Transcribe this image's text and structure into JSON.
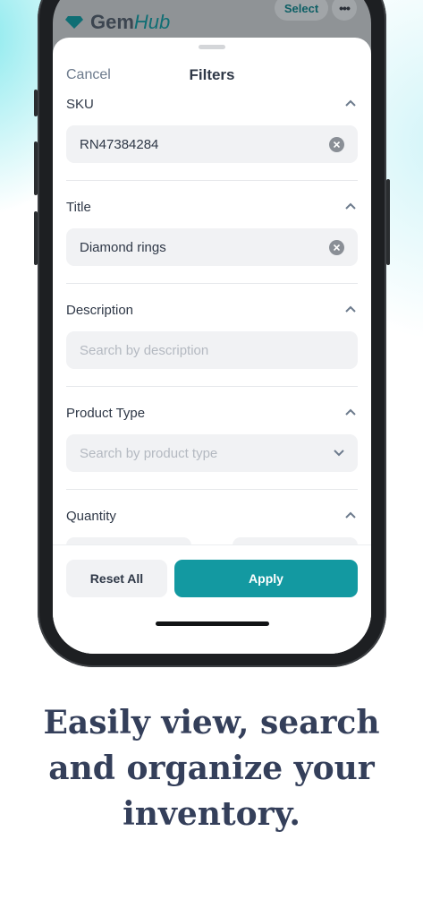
{
  "app": {
    "logo_main": "Gem",
    "logo_accent": "Hub",
    "select_label": "Select",
    "more_label": "•••"
  },
  "sheet": {
    "cancel_label": "Cancel",
    "title": "Filters"
  },
  "filters": {
    "sku": {
      "label": "SKU",
      "value": "RN47384284"
    },
    "title": {
      "label": "Title",
      "value": "Diamond rings"
    },
    "description": {
      "label": "Description",
      "placeholder": "Search by description"
    },
    "product_type": {
      "label": "Product Type",
      "placeholder": "Search by product type"
    },
    "quantity": {
      "label": "Quantity"
    }
  },
  "footer": {
    "reset_label": "Reset All",
    "apply_label": "Apply"
  },
  "tagline": {
    "line1": "Easily view, search",
    "line2": "and organize your",
    "line3": "inventory."
  },
  "colors": {
    "accent": "#1399a1",
    "text": "#2f3847",
    "tagline": "#343f5a"
  },
  "icons": {
    "logo": "gem-icon",
    "clear": "clear-icon",
    "collapse": "chevron-up-icon",
    "dropdown": "chevron-down-icon"
  }
}
